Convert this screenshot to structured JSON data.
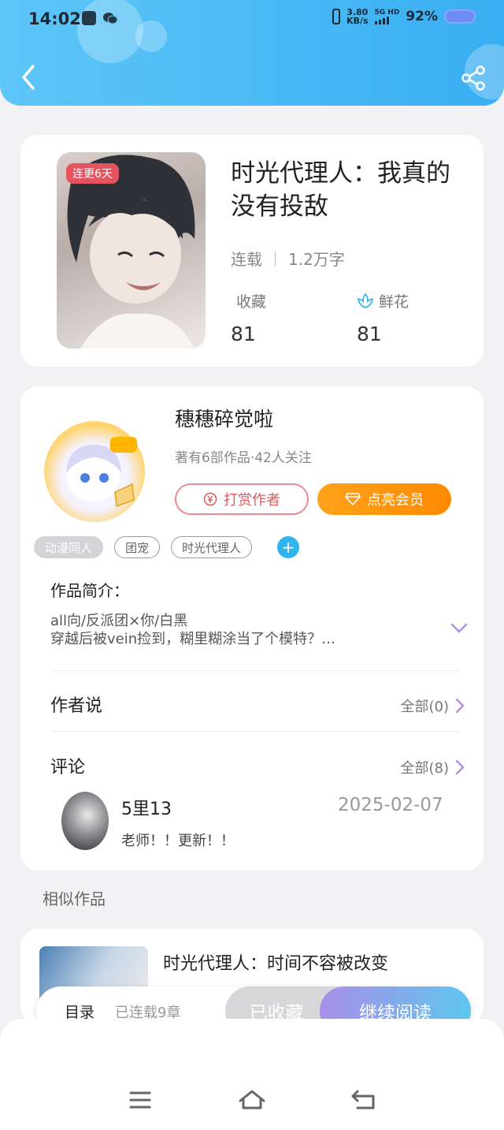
{
  "status_bar": {
    "time": "14:02",
    "network_speed_value": "3.80",
    "network_speed_unit": "KB/s",
    "signal_label": "5G HD",
    "battery": "92%"
  },
  "header": {
    "back_icon": "chevron-left-icon",
    "share_icon": "share-icon",
    "accent": "#47b8f5"
  },
  "book": {
    "cover_badge": "连更6天",
    "title": "时光代理人：我真的没有投敌",
    "status": "连载",
    "word_count": "1.2万字",
    "favorites_label": "收藏",
    "favorites_count": "81",
    "flowers_label": "鲜花",
    "flowers_count": "81"
  },
  "author": {
    "name": "穗穗碎觉啦",
    "subtitle": "著有6部作品·42人关注",
    "reward_label": "打赏作者",
    "member_label": "点亮会员"
  },
  "tags": [
    "动漫同人",
    "团宠",
    "时光代理人"
  ],
  "intro": {
    "label": "作品简介：",
    "line1": "all向/反派团×你/白黑",
    "line2": "穿越后被vein捡到，糊里糊涂当了个模特？…"
  },
  "author_says": {
    "title": "作者说",
    "more": "全部(0)"
  },
  "comments": {
    "title": "评论",
    "more": "全部(8)",
    "items": [
      {
        "user": "5里13",
        "date": "2025-02-07",
        "text": "老师！！更新！！"
      }
    ]
  },
  "similar": {
    "label": "相似作品",
    "items": [
      {
        "title": "时光代理人：时间不容被改变"
      }
    ]
  },
  "bottom_bar": {
    "toc": "目录",
    "chapters": "已连载9章",
    "saved": "已收藏",
    "read": "继续阅读"
  },
  "system_nav": {
    "menu_icon": "menu-icon",
    "home_icon": "home-icon",
    "back_icon": "back-icon"
  }
}
